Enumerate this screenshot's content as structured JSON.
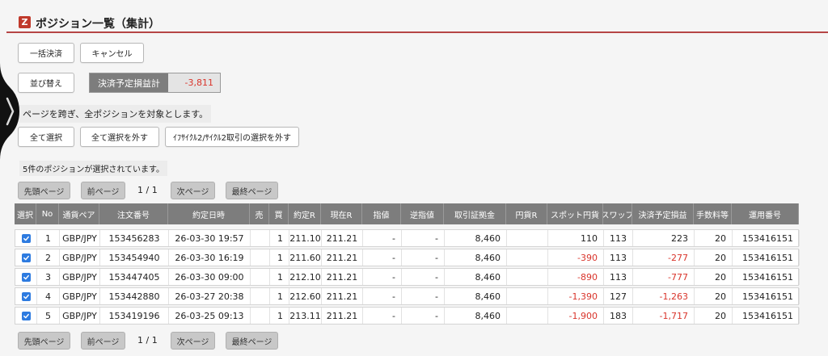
{
  "header": {
    "logo": "Z",
    "title": "ポジション一覧（集計）"
  },
  "actions": {
    "bulk_settle": "一括決済",
    "cancel": "キャンセル",
    "sort": "並び替え"
  },
  "summary": {
    "label": "決済予定損益計",
    "value": "-3,811"
  },
  "notes": {
    "cross_page": "ページを跨ぎ、全ポジションを対象とします。",
    "selected_count": "5件のポジションが選択されています。"
  },
  "selection": {
    "select_all": "全て選択",
    "deselect_all": "全て選択を外す",
    "deselect_cycle": "ｲﾌｻｲｸﾙ2/ｻｲｸﾙ2取引の選択を外す"
  },
  "pagination": {
    "first": "先頭ページ",
    "prev": "前ページ",
    "count": "1 / 1",
    "next": "次ページ",
    "last": "最終ページ"
  },
  "table": {
    "headers": [
      "選択",
      "No",
      "通貨ペア",
      "注文番号",
      "約定日時",
      "売",
      "買",
      "約定R",
      "現在R",
      "指値",
      "逆指値",
      "取引証拠金",
      "円貨R",
      "スポット円貨",
      "スワップ",
      "決済予定損益",
      "手数料等",
      "運用番号"
    ],
    "rows": [
      {
        "checked": true,
        "no": "1",
        "pair": "GBP/JPY",
        "order": "153456283",
        "datetime": "26-03-30 19:57",
        "sell": "",
        "buy": "1",
        "exec_rate": "211.10",
        "current_rate": "211.21",
        "limit": "-",
        "stop": "-",
        "margin": "8,460",
        "yen_rate": "",
        "spot_yen": "110",
        "swap": "113",
        "pl": "223",
        "fee": "20",
        "op_no": "153416151"
      },
      {
        "checked": true,
        "no": "2",
        "pair": "GBP/JPY",
        "order": "153454940",
        "datetime": "26-03-30 16:19",
        "sell": "",
        "buy": "1",
        "exec_rate": "211.60",
        "current_rate": "211.21",
        "limit": "-",
        "stop": "-",
        "margin": "8,460",
        "yen_rate": "",
        "spot_yen": "-390",
        "swap": "113",
        "pl": "-277",
        "fee": "20",
        "op_no": "153416151"
      },
      {
        "checked": true,
        "no": "3",
        "pair": "GBP/JPY",
        "order": "153447405",
        "datetime": "26-03-30 09:00",
        "sell": "",
        "buy": "1",
        "exec_rate": "212.10",
        "current_rate": "211.21",
        "limit": "-",
        "stop": "-",
        "margin": "8,460",
        "yen_rate": "",
        "spot_yen": "-890",
        "swap": "113",
        "pl": "-777",
        "fee": "20",
        "op_no": "153416151"
      },
      {
        "checked": true,
        "no": "4",
        "pair": "GBP/JPY",
        "order": "153442880",
        "datetime": "26-03-27 20:38",
        "sell": "",
        "buy": "1",
        "exec_rate": "212.60",
        "current_rate": "211.21",
        "limit": "-",
        "stop": "-",
        "margin": "8,460",
        "yen_rate": "",
        "spot_yen": "-1,390",
        "swap": "127",
        "pl": "-1,263",
        "fee": "20",
        "op_no": "153416151"
      },
      {
        "checked": true,
        "no": "5",
        "pair": "GBP/JPY",
        "order": "153419196",
        "datetime": "26-03-25 09:13",
        "sell": "",
        "buy": "1",
        "exec_rate": "213.11",
        "current_rate": "211.21",
        "limit": "-",
        "stop": "-",
        "margin": "8,460",
        "yen_rate": "",
        "spot_yen": "-1,900",
        "swap": "183",
        "pl": "-1,717",
        "fee": "20",
        "op_no": "153416151"
      }
    ]
  },
  "colors": {
    "accent_red": "#b54545",
    "negative": "#d9342b",
    "header_gray": "#7d7d7d",
    "checkbox": "#2d7be0"
  },
  "icons": {
    "side_tab": "chevron-right-icon",
    "check": "check-icon"
  }
}
